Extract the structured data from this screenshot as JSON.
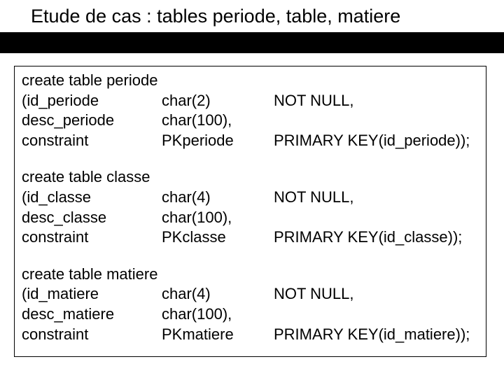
{
  "title": "Etude de cas : tables periode, table, matiere",
  "blocks": [
    {
      "header": "create table periode",
      "rows": [
        {
          "c1": "(id_periode",
          "c2": "char(2)",
          "c3": "NOT NULL,"
        },
        {
          "c1": "desc_periode",
          "c2": "char(100),",
          "c3": ""
        },
        {
          "c1": "constraint",
          "c2": "PKperiode",
          "c3": "PRIMARY KEY(id_periode));"
        }
      ]
    },
    {
      "header": "create table classe",
      "rows": [
        {
          "c1": "(id_classe",
          "c2": "char(4)",
          "c3": "NOT NULL,"
        },
        {
          "c1": "desc_classe",
          "c2": "char(100),",
          "c3": ""
        },
        {
          "c1": "constraint",
          "c2": "PKclasse",
          "c3": "PRIMARY KEY(id_classe));"
        }
      ]
    },
    {
      "header": "create table matiere",
      "rows": [
        {
          "c1": "(id_matiere",
          "c2": "char(4)",
          "c3": "NOT NULL,"
        },
        {
          "c1": "desc_matiere",
          "c2": "char(100),",
          "c3": ""
        },
        {
          "c1": "constraint",
          "c2": "PKmatiere",
          "c3": "PRIMARY KEY(id_matiere));"
        }
      ]
    }
  ]
}
